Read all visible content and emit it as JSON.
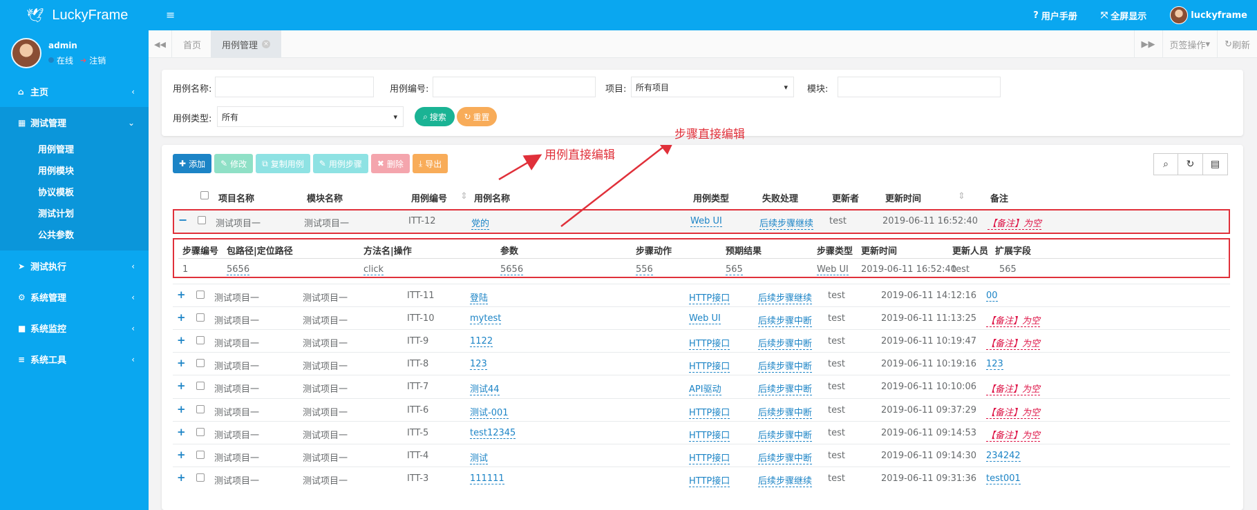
{
  "app": {
    "title": "LuckyFrame"
  },
  "user_panel": {
    "name": "admin",
    "status": "在线",
    "logout": "注销"
  },
  "sidebar": {
    "items": [
      {
        "label": "主页",
        "icon": "home-icon"
      },
      {
        "label": "测试管理",
        "icon": "grid-icon"
      },
      {
        "label": "测试执行",
        "icon": "send-icon"
      },
      {
        "label": "系统管理",
        "icon": "gear-icon"
      },
      {
        "label": "系统监控",
        "icon": "video-icon"
      },
      {
        "label": "系统工具",
        "icon": "bars-icon"
      }
    ],
    "sub_items": [
      "用例管理",
      "用例模块",
      "协议模板",
      "测试计划",
      "公共参数"
    ]
  },
  "topbar": {
    "manual": "用户手册",
    "fullscreen": "全屏显示",
    "username": "luckyframe"
  },
  "tabs": {
    "home": "首页",
    "active": "用例管理",
    "tab_ops": "页签操作",
    "refresh": "刷新"
  },
  "search": {
    "case_name_label": "用例名称:",
    "case_name_value": "",
    "case_id_label": "用例编号:",
    "case_id_value": "",
    "project_label": "项目:",
    "project_value": "所有项目",
    "module_label": "模块:",
    "module_value": "",
    "case_type_label": "用例类型:",
    "case_type_value": "所有",
    "search_btn": "搜索",
    "reset_btn": "重置"
  },
  "toolbar": {
    "add": "添加",
    "edit": "修改",
    "copy": "复制用例",
    "steps": "用例步骤",
    "delete": "删除",
    "export": "导出"
  },
  "colors": {
    "primary": "#0aa7f0",
    "blue": "#1c84c6",
    "teal": "#1ab394",
    "cyan": "#23c6c8",
    "red": "#ed5565",
    "orange": "#f8ac59",
    "annotation": "#e0303a"
  },
  "table": {
    "headers": [
      "项目名称",
      "模块名称",
      "用例编号",
      "用例名称",
      "用例类型",
      "失败处理",
      "更新者",
      "更新时间",
      "备注"
    ],
    "expanded": {
      "project": "测试项目一",
      "module": "测试项目一",
      "id": "ITT-12",
      "name": "党的",
      "type": "Web UI",
      "fail": "后续步骤继续",
      "updater": "test",
      "time": "2019-06-11 16:52:40",
      "note": "【备注】为空"
    },
    "detail_headers": [
      "步骤编号",
      "包路径|定位路径",
      "方法名|操作",
      "参数",
      "步骤动作",
      "预期结果",
      "步骤类型",
      "更新时间",
      "更新人员",
      "扩展字段"
    ],
    "detail_row": [
      "1",
      "5656",
      "click",
      "5656",
      "556",
      "565",
      "Web UI",
      "2019-06-11 16:52:40",
      "test",
      "565"
    ],
    "rows": [
      {
        "project": "测试项目一",
        "module": "测试项目一",
        "id": "ITT-11",
        "name": "登陆",
        "type": "HTTP接口",
        "fail": "后续步骤继续",
        "updater": "test",
        "time": "2019-06-11 14:12:16",
        "note": "00"
      },
      {
        "project": "测试项目一",
        "module": "测试项目一",
        "id": "ITT-10",
        "name": "mytest",
        "type": "Web UI",
        "fail": "后续步骤中断",
        "updater": "test",
        "time": "2019-06-11 11:13:25",
        "note": "【备注】为空"
      },
      {
        "project": "测试项目一",
        "module": "测试项目一",
        "id": "ITT-9",
        "name": "1122",
        "type": "HTTP接口",
        "fail": "后续步骤中断",
        "updater": "test",
        "time": "2019-06-11 10:19:47",
        "note": "【备注】为空"
      },
      {
        "project": "测试项目一",
        "module": "测试项目一",
        "id": "ITT-8",
        "name": "123",
        "type": "HTTP接口",
        "fail": "后续步骤中断",
        "updater": "test",
        "time": "2019-06-11 10:19:16",
        "note": "123"
      },
      {
        "project": "测试项目一",
        "module": "测试项目一",
        "id": "ITT-7",
        "name": "测试44",
        "type": "API驱动",
        "fail": "后续步骤中断",
        "updater": "test",
        "time": "2019-06-11 10:10:06",
        "note": "【备注】为空"
      },
      {
        "project": "测试项目一",
        "module": "测试项目一",
        "id": "ITT-6",
        "name": "测试-001",
        "type": "HTTP接口",
        "fail": "后续步骤中断",
        "updater": "test",
        "time": "2019-06-11 09:37:29",
        "note": "【备注】为空"
      },
      {
        "project": "测试项目一",
        "module": "测试项目一",
        "id": "ITT-5",
        "name": "test12345",
        "type": "HTTP接口",
        "fail": "后续步骤中断",
        "updater": "test",
        "time": "2019-06-11 09:14:53",
        "note": "【备注】为空"
      },
      {
        "project": "测试项目一",
        "module": "测试项目一",
        "id": "ITT-4",
        "name": "测试",
        "type": "HTTP接口",
        "fail": "后续步骤中断",
        "updater": "test",
        "time": "2019-06-11 09:14:30",
        "note": "234242"
      },
      {
        "project": "测试项目一",
        "module": "测试项目一",
        "id": "ITT-3",
        "name": "111111",
        "type": "HTTP接口",
        "fail": "后续步骤继续",
        "updater": "test",
        "time": "2019-06-11 09:31:36",
        "note": "test001"
      }
    ]
  },
  "annotations": {
    "case_edit": "用例直接编辑",
    "step_edit": "步骤直接编辑"
  }
}
